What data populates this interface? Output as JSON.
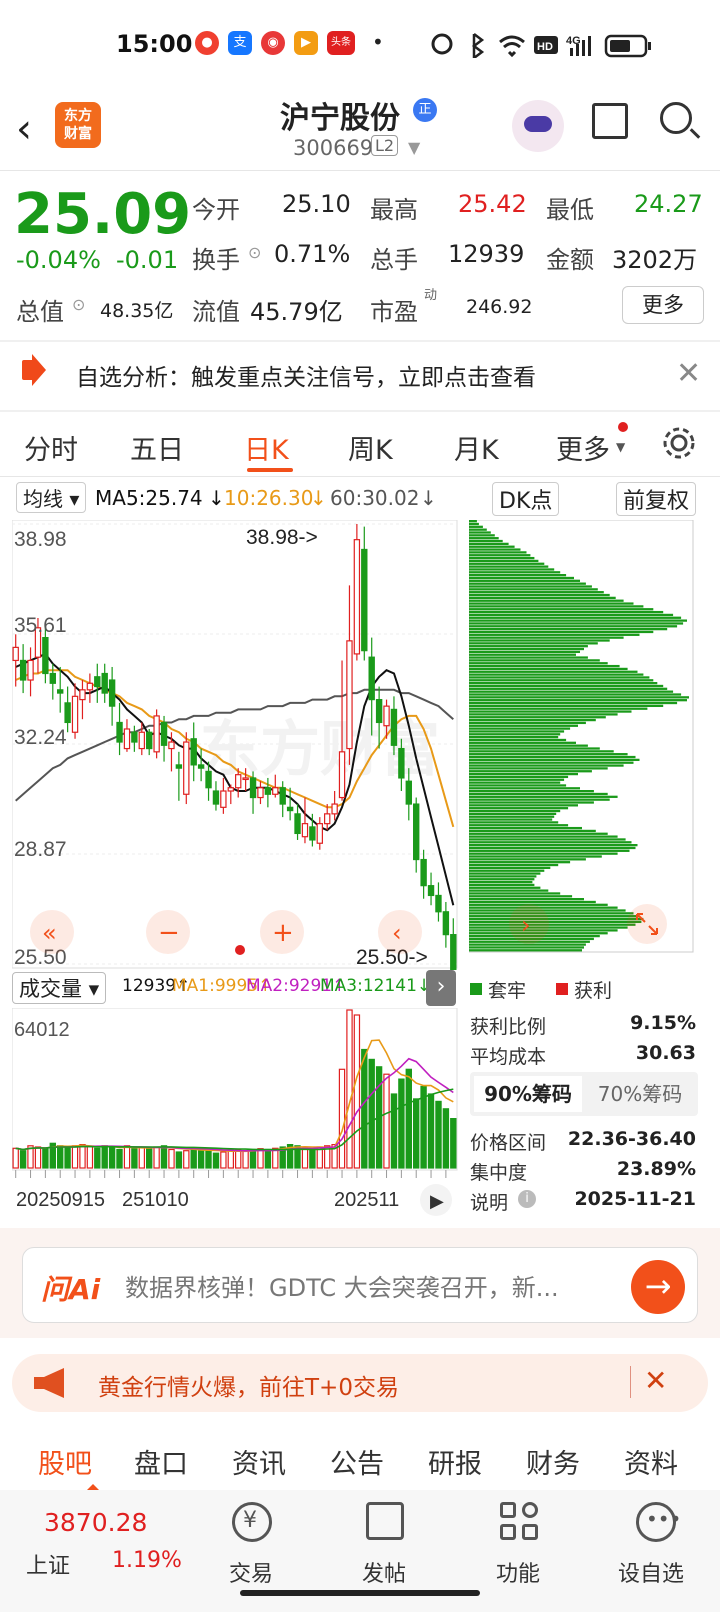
{
  "status_bar": {
    "time": "15:00",
    "dot": "•",
    "notif_icons": [
      "alipay-icon",
      "fire-icon",
      "video-icon",
      "toutiao-icon"
    ],
    "toutiao_label": "头条"
  },
  "header": {
    "back": "‹",
    "logo_line1": "东方",
    "logo_line2": "财富",
    "stock_name": "沪宁股份",
    "badge": "正",
    "stock_code": "300669",
    "level": "L2"
  },
  "quote": {
    "price": "25.09",
    "change_pct": "-0.04%",
    "change": "-0.01",
    "open_label": "今开",
    "open": "25.10",
    "high_label": "最高",
    "high": "25.42",
    "low_label": "最低",
    "low": "24.27",
    "turnover_label": "换手",
    "turnover": "0.71%",
    "volume_label": "总手",
    "volume": "12939",
    "amount_label": "金额",
    "amount": "3202万",
    "mktcap_label": "总值",
    "mktcap": "48.35亿",
    "float_label": "流值",
    "float": "45.79亿",
    "pe_label": "市盈",
    "pe_sup": "动",
    "pe": "246.92",
    "more_label": "更多"
  },
  "alert": {
    "text": "自选分析：触发重点关注信号，立即点击查看",
    "close": "✕"
  },
  "chart_tabs": [
    {
      "label": "分时",
      "active": false
    },
    {
      "label": "五日",
      "active": false
    },
    {
      "label": "日K",
      "active": true
    },
    {
      "label": "周K",
      "active": false
    },
    {
      "label": "月K",
      "active": false
    },
    {
      "label": "更多",
      "active": false
    }
  ],
  "ma_bar": {
    "ma_select": "均线",
    "ma5": "MA5:25.74",
    "ma10": "10:26.30",
    "ma60": "60:30.02",
    "dk_label": "DK点",
    "adjust_label": "前复权"
  },
  "colors": {
    "up": "#e02020",
    "down": "#1a9a1a",
    "accent": "#f2501a",
    "ma5": "#111111",
    "ma10": "#e89a18",
    "ma60": "#555555",
    "ma_vol2": "#c020c0"
  },
  "chart_data": {
    "type": "candlestick",
    "y_ticks": [
      "38.98",
      "35.61",
      "32.24",
      "28.87",
      "25.50"
    ],
    "ylim": [
      25.5,
      38.98
    ],
    "max_label": "38.98->",
    "min_label": "25.50->",
    "candles": [
      [
        34.8,
        35.2,
        34.0,
        35.6
      ],
      [
        34.8,
        34.2,
        33.8,
        35.3
      ],
      [
        34.2,
        34.8,
        33.7,
        35.2
      ],
      [
        34.9,
        35.8,
        34.4,
        36.1
      ],
      [
        35.5,
        34.4,
        34.1,
        35.9
      ],
      [
        34.4,
        34.1,
        33.6,
        34.7
      ],
      [
        33.9,
        33.8,
        33.2,
        34.6
      ],
      [
        33.5,
        32.9,
        32.6,
        34.0
      ],
      [
        32.6,
        33.7,
        32.4,
        34.1
      ],
      [
        33.6,
        33.9,
        33.0,
        34.2
      ],
      [
        33.9,
        34.1,
        33.5,
        34.4
      ],
      [
        34.3,
        34.0,
        33.5,
        34.7
      ],
      [
        34.4,
        33.8,
        33.5,
        34.7
      ],
      [
        34.2,
        33.4,
        32.8,
        34.6
      ],
      [
        32.9,
        32.3,
        31.9,
        33.5
      ],
      [
        32.1,
        32.7,
        32.0,
        33.0
      ],
      [
        32.6,
        32.3,
        32.0,
        32.8
      ],
      [
        32.1,
        32.6,
        31.9,
        32.9
      ],
      [
        32.6,
        32.1,
        31.9,
        32.7
      ],
      [
        32.0,
        33.1,
        31.8,
        33.3
      ],
      [
        32.9,
        32.2,
        31.7,
        33.1
      ],
      [
        32.1,
        32.3,
        31.4,
        32.6
      ],
      [
        31.6,
        31.5,
        30.5,
        32.0
      ],
      [
        30.7,
        32.3,
        30.4,
        32.6
      ],
      [
        32.4,
        31.6,
        31.1,
        32.9
      ],
      [
        31.6,
        31.5,
        31.1,
        32.1
      ],
      [
        31.4,
        30.9,
        30.5,
        31.7
      ],
      [
        30.8,
        30.4,
        30.2,
        31.1
      ],
      [
        30.3,
        30.8,
        30.1,
        31.2
      ],
      [
        30.8,
        30.9,
        30.4,
        31.0
      ],
      [
        30.9,
        31.3,
        30.6,
        31.5
      ],
      [
        31.2,
        31.2,
        30.8,
        31.5
      ],
      [
        31.2,
        30.6,
        30.1,
        31.4
      ],
      [
        30.6,
        30.9,
        30.4,
        31.1
      ],
      [
        30.9,
        30.7,
        30.3,
        31.2
      ],
      [
        30.7,
        30.9,
        30.6,
        31.3
      ],
      [
        30.9,
        30.4,
        30.0,
        31.1
      ],
      [
        30.3,
        30.2,
        29.9,
        30.9
      ],
      [
        30.1,
        29.5,
        29.3,
        30.4
      ],
      [
        29.4,
        29.8,
        29.2,
        30.6
      ],
      [
        29.7,
        29.3,
        29.1,
        30.1
      ],
      [
        29.2,
        29.8,
        29.0,
        30.0
      ],
      [
        29.8,
        30.1,
        29.6,
        30.4
      ],
      [
        30.1,
        30.4,
        29.9,
        30.8
      ],
      [
        30.6,
        32.0,
        30.5,
        34.8
      ],
      [
        32.1,
        35.4,
        31.6,
        37.1
      ],
      [
        35.0,
        38.5,
        34.8,
        38.98
      ],
      [
        38.2,
        35.1,
        34.8,
        38.9
      ],
      [
        34.9,
        33.6,
        32.5,
        35.5
      ],
      [
        33.6,
        32.9,
        32.1,
        34.0
      ],
      [
        32.8,
        33.4,
        32.4,
        33.6
      ],
      [
        33.3,
        32.2,
        31.9,
        33.7
      ],
      [
        32.1,
        31.2,
        30.8,
        32.4
      ],
      [
        31.1,
        30.4,
        29.9,
        31.5
      ],
      [
        30.4,
        28.7,
        28.3,
        30.6
      ],
      [
        28.7,
        27.9,
        27.5,
        29.0
      ],
      [
        27.9,
        27.6,
        27.3,
        28.3
      ],
      [
        27.6,
        27.1,
        26.8,
        28.0
      ],
      [
        27.1,
        26.4,
        26.0,
        27.4
      ],
      [
        26.4,
        25.09,
        24.27,
        26.9
      ]
    ],
    "ma5": [
      34.6,
      34.7,
      34.8,
      34.9,
      35.0,
      34.7,
      34.5,
      34.3,
      34.0,
      33.8,
      33.8,
      33.9,
      34.0,
      33.8,
      33.6,
      33.3,
      33.1,
      32.9,
      32.5,
      32.6,
      32.5,
      32.4,
      32.2,
      32.1,
      32.1,
      31.8,
      31.6,
      31.4,
      31.3,
      30.9,
      30.8,
      30.8,
      30.9,
      30.9,
      30.9,
      30.8,
      30.7,
      30.6,
      30.4,
      30.1,
      29.9,
      29.7,
      29.6,
      29.8,
      30.3,
      31.0,
      32.3,
      33.4,
      34.0,
      34.3,
      34.5,
      34.4,
      33.7,
      32.8,
      31.8,
      30.9,
      30.0,
      29.1,
      28.2,
      27.3
    ],
    "ma10": [
      34.2,
      34.3,
      34.4,
      34.4,
      34.5,
      34.5,
      34.5,
      34.5,
      34.3,
      34.2,
      34.1,
      34.0,
      33.9,
      33.8,
      33.7,
      33.5,
      33.4,
      33.3,
      33.1,
      33.0,
      32.9,
      32.7,
      32.6,
      32.4,
      32.3,
      32.1,
      32.0,
      31.9,
      31.7,
      31.6,
      31.4,
      31.3,
      31.2,
      31.1,
      31.0,
      30.9,
      30.9,
      30.8,
      30.7,
      30.6,
      30.5,
      30.4,
      30.3,
      30.3,
      30.4,
      30.6,
      31.1,
      31.5,
      31.9,
      32.2,
      32.5,
      32.8,
      33.0,
      33.1,
      33.1,
      32.7,
      32.1,
      31.3,
      30.5,
      29.7
    ],
    "ma60": [
      30.5,
      30.7,
      30.9,
      31.1,
      31.3,
      31.5,
      31.6,
      31.8,
      31.9,
      32.0,
      32.1,
      32.2,
      32.3,
      32.4,
      32.5,
      32.6,
      32.6,
      32.7,
      32.8,
      32.8,
      32.9,
      32.9,
      33.0,
      33.0,
      33.1,
      33.1,
      33.1,
      33.2,
      33.2,
      33.2,
      33.3,
      33.3,
      33.3,
      33.3,
      33.4,
      33.4,
      33.4,
      33.5,
      33.5,
      33.5,
      33.6,
      33.6,
      33.6,
      33.7,
      33.7,
      33.8,
      33.8,
      33.9,
      33.9,
      33.9,
      33.9,
      33.9,
      33.8,
      33.8,
      33.7,
      33.6,
      33.5,
      33.4,
      33.2,
      33.0
    ]
  },
  "chart_controls": {
    "left": "«",
    "minus": "−",
    "plus": "+",
    "prev": "‹",
    "next": "›"
  },
  "volume": {
    "select_label": "成交量",
    "vol": "12939↑",
    "ma1": "MA1:9995↑",
    "ma2": "MA2:9291↑",
    "ma3": "MA3:12141↓",
    "max_label": "64012",
    "max": 64012,
    "date1": "20250915",
    "date2": "251010",
    "date3": "202511",
    "values": [
      8000,
      7000,
      9000,
      8500,
      8000,
      10000,
      9000,
      8500,
      9000,
      9500,
      8800,
      8000,
      9000,
      8500,
      7500,
      9000,
      7800,
      8200,
      8000,
      8500,
      9000,
      7500,
      6500,
      7000,
      8000,
      7500,
      7000,
      6000,
      6500,
      7000,
      7500,
      6800,
      7000,
      7800,
      7500,
      8000,
      8500,
      9500,
      9000,
      8000,
      7500,
      8500,
      9000,
      9500,
      40000,
      64012,
      62000,
      48000,
      44000,
      41000,
      38000,
      30000,
      36000,
      40000,
      28000,
      33000,
      30000,
      27000,
      24000,
      20000
    ]
  },
  "chips": {
    "legend_trapped": "套牢",
    "legend_profit": "获利",
    "profit_ratio_label": "获利比例",
    "profit_ratio": "9.15%",
    "avg_cost_label": "平均成本",
    "avg_cost": "30.63",
    "tab90": "90%筹码",
    "tab70": "70%筹码",
    "range_label": "价格区间",
    "range": "22.36-36.40",
    "concentration_label": "集中度",
    "concentration": "23.89%",
    "note_label": "说明",
    "date": "2025-11-21",
    "distribution": [
      8,
      10,
      14,
      18,
      22,
      26,
      30,
      34,
      40,
      46,
      52,
      58,
      62,
      66,
      70,
      76,
      80,
      86,
      92,
      98,
      106,
      112,
      118,
      124,
      130,
      136,
      142,
      148,
      156,
      166,
      176,
      186,
      196,
      206,
      214,
      220,
      216,
      210,
      200,
      186,
      172,
      156,
      142,
      130,
      120,
      116,
      112,
      108,
      120,
      132,
      140,
      152,
      160,
      170,
      176,
      182,
      186,
      190,
      196,
      200,
      206,
      214,
      222,
      220,
      210,
      196,
      180,
      164,
      150,
      138,
      128,
      118,
      110,
      102,
      96,
      92,
      90,
      98,
      108,
      120,
      132,
      146,
      160,
      168,
      172,
      166,
      156,
      140,
      124,
      110,
      100,
      96,
      92,
      98,
      112,
      126,
      140,
      150,
      142,
      126,
      110,
      100,
      92,
      88,
      86,
      84,
      90,
      100,
      114,
      128,
      140,
      150,
      158,
      164,
      170,
      168,
      162,
      150,
      134,
      118,
      102,
      90,
      82,
      76,
      72,
      68,
      66,
      64,
      66,
      72,
      80,
      92,
      104,
      116,
      128,
      140,
      150,
      158,
      166,
      172,
      176,
      174,
      168,
      160,
      150,
      140,
      132,
      126,
      122,
      118,
      116,
      114
    ]
  },
  "ai_bar": {
    "logo": "问Ai",
    "text": "数据界核弹！GDTC 大会突袭召开，新...",
    "go": "→"
  },
  "gold_banner": {
    "text": "黄金行情火爆，前往T+0交易",
    "close": "✕"
  },
  "bottom_tabs": [
    {
      "label": "股吧",
      "active": true
    },
    {
      "label": "盘口",
      "active": false
    },
    {
      "label": "资讯",
      "active": false
    },
    {
      "label": "公告",
      "active": false
    },
    {
      "label": "研报",
      "active": false
    },
    {
      "label": "财务",
      "active": false
    },
    {
      "label": "资料",
      "active": false
    }
  ],
  "footer": {
    "index_value": "3870.28",
    "index_name": "上证",
    "index_change": "1.19%",
    "trade": "交易",
    "post": "发帖",
    "functions": "功能",
    "set_watch": "设自选"
  }
}
